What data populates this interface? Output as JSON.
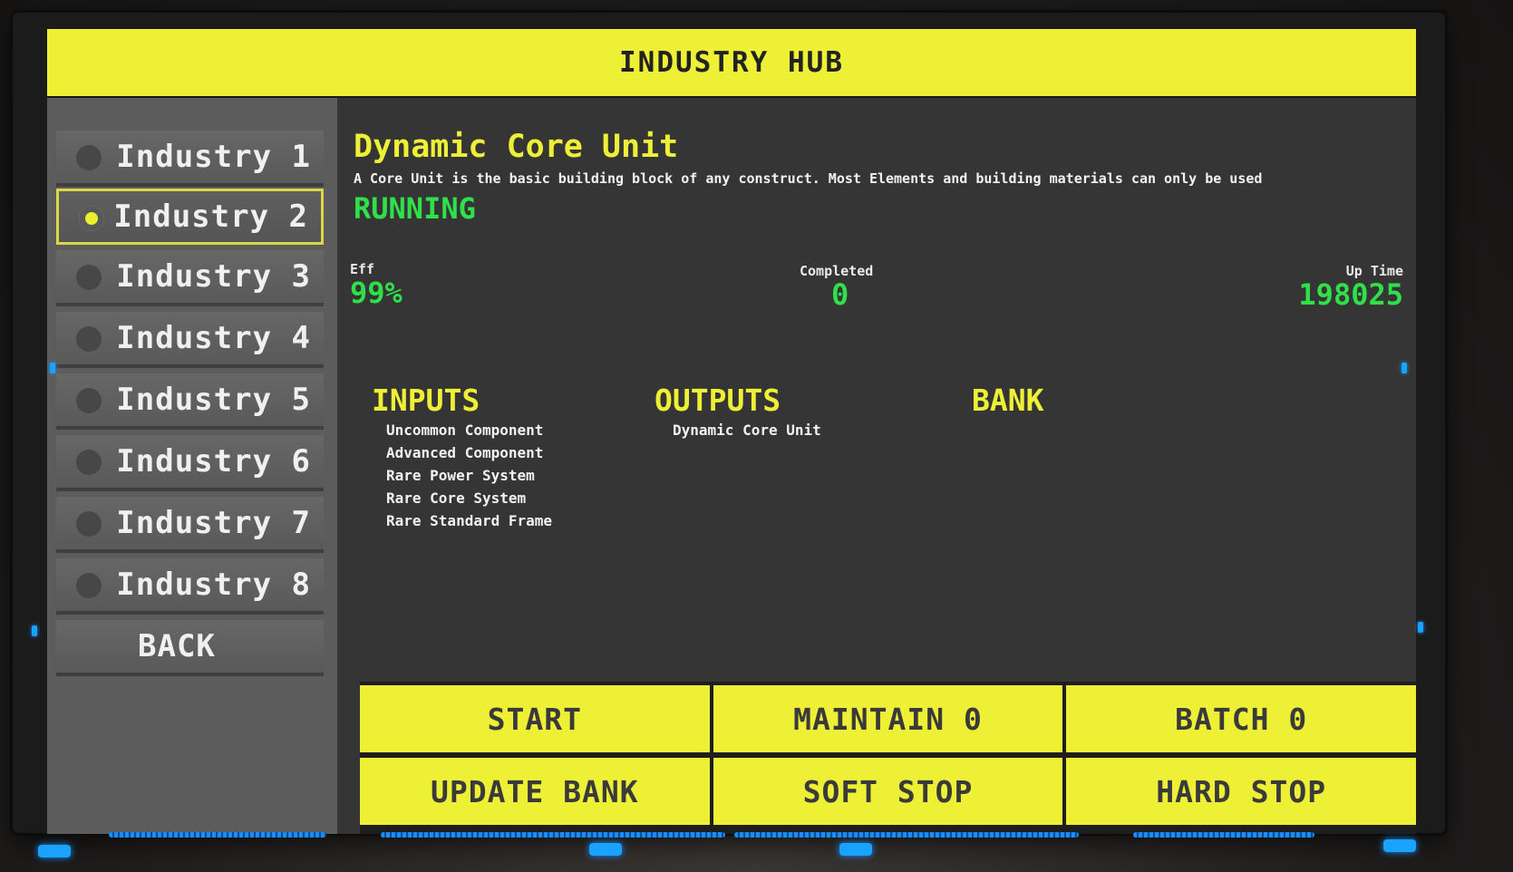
{
  "header": {
    "title": "INDUSTRY HUB"
  },
  "sidebar": {
    "items": [
      {
        "label": "Industry 1",
        "active": false
      },
      {
        "label": "Industry 2",
        "active": true
      },
      {
        "label": "Industry 3",
        "active": false
      },
      {
        "label": "Industry 4",
        "active": false
      },
      {
        "label": "Industry 5",
        "active": false
      },
      {
        "label": "Industry 6",
        "active": false
      },
      {
        "label": "Industry 7",
        "active": false
      },
      {
        "label": "Industry 8",
        "active": false
      }
    ],
    "back_label": "BACK"
  },
  "detail": {
    "title": "Dynamic Core Unit",
    "description": "A Core Unit is the basic building block of any construct. Most Elements and building materials can only be used",
    "status": "RUNNING",
    "stats": {
      "eff_label": "Eff",
      "eff_value": "99%",
      "completed_label": "Completed",
      "completed_value": "0",
      "uptime_label": "Up Time",
      "uptime_value": "198025"
    },
    "inputs_title": "INPUTS",
    "inputs": [
      "Uncommon Component",
      "Advanced Component",
      "Rare Power System",
      "Rare Core System",
      "Rare Standard Frame"
    ],
    "outputs_title": "OUTPUTS",
    "outputs": [
      "Dynamic Core Unit"
    ],
    "bank_title": "BANK"
  },
  "buttons": {
    "start": "START",
    "maintain": "MAINTAIN 0",
    "batch": "BATCH 0",
    "update_bank": "UPDATE BANK",
    "soft_stop": "SOFT STOP",
    "hard_stop": "HARD STOP"
  },
  "colors": {
    "accent": "#eef036",
    "running": "#2fe04a",
    "panel": "#353535",
    "sidebar": "#5c5c5c"
  }
}
